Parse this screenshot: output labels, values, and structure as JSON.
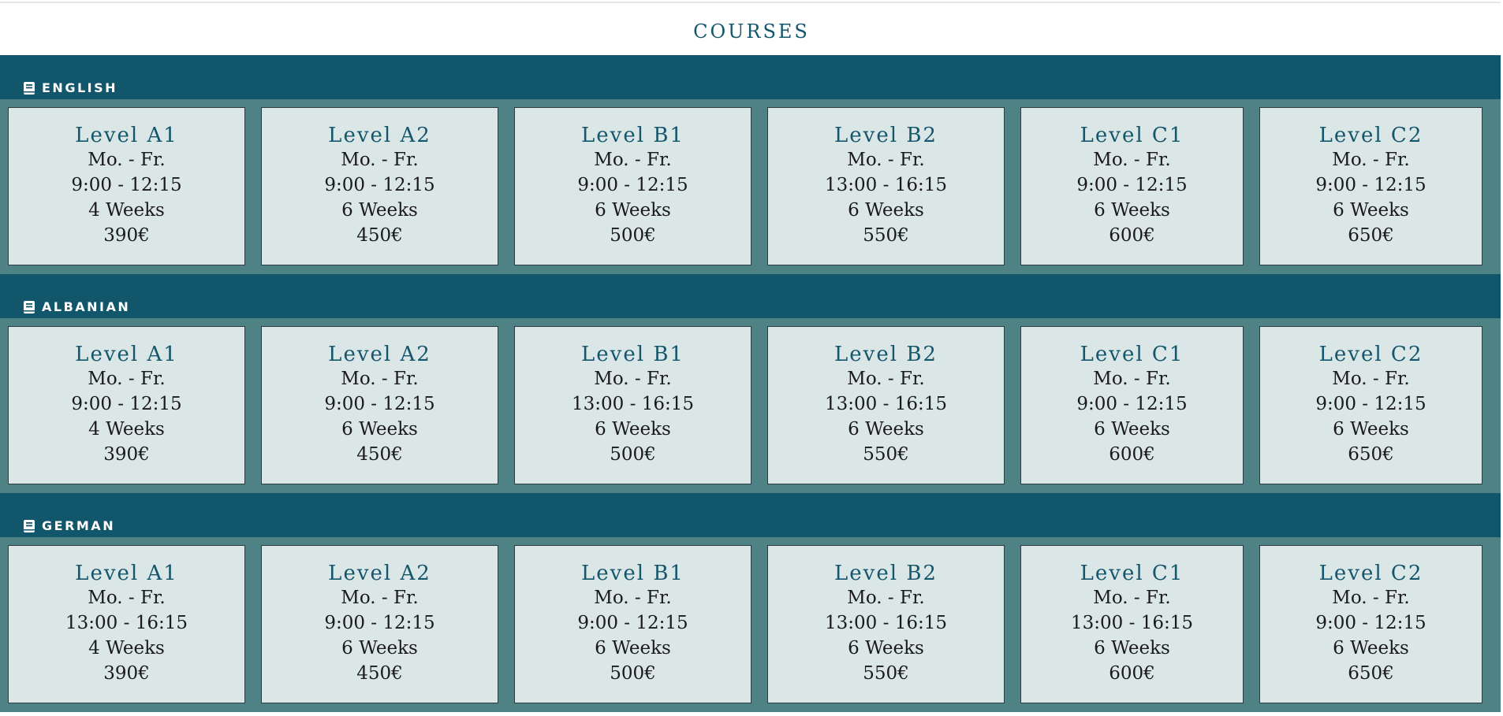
{
  "page": {
    "title": "COURSES"
  },
  "sections": [
    {
      "name": "ENGLISH",
      "icon": "book-icon",
      "courses": [
        {
          "level": "Level A1",
          "days": "Mo. - Fr.",
          "time": "9:00 - 12:15",
          "duration": "4 Weeks",
          "price": "390€"
        },
        {
          "level": "Level A2",
          "days": "Mo. - Fr.",
          "time": "9:00 - 12:15",
          "duration": "6 Weeks",
          "price": "450€"
        },
        {
          "level": "Level B1",
          "days": "Mo. - Fr.",
          "time": "9:00 - 12:15",
          "duration": "6 Weeks",
          "price": "500€"
        },
        {
          "level": "Level B2",
          "days": "Mo. - Fr.",
          "time": "13:00 - 16:15",
          "duration": "6 Weeks",
          "price": "550€"
        },
        {
          "level": "Level C1",
          "days": "Mo. - Fr.",
          "time": "9:00 - 12:15",
          "duration": "6 Weeks",
          "price": "600€"
        },
        {
          "level": "Level C2",
          "days": "Mo. - Fr.",
          "time": "9:00 - 12:15",
          "duration": "6 Weeks",
          "price": "650€"
        }
      ]
    },
    {
      "name": "ALBANIAN",
      "icon": "book-icon",
      "courses": [
        {
          "level": "Level A1",
          "days": "Mo. - Fr.",
          "time": "9:00 - 12:15",
          "duration": "4 Weeks",
          "price": "390€"
        },
        {
          "level": "Level A2",
          "days": "Mo. - Fr.",
          "time": "9:00 - 12:15",
          "duration": "6 Weeks",
          "price": "450€"
        },
        {
          "level": "Level B1",
          "days": "Mo. - Fr.",
          "time": "13:00 - 16:15",
          "duration": "6 Weeks",
          "price": "500€"
        },
        {
          "level": "Level B2",
          "days": "Mo. - Fr.",
          "time": "13:00 - 16:15",
          "duration": "6 Weeks",
          "price": "550€"
        },
        {
          "level": "Level C1",
          "days": "Mo. - Fr.",
          "time": "9:00 - 12:15",
          "duration": "6 Weeks",
          "price": "600€"
        },
        {
          "level": "Level C2",
          "days": "Mo. - Fr.",
          "time": "9:00 - 12:15",
          "duration": "6 Weeks",
          "price": "650€"
        }
      ]
    },
    {
      "name": "GERMAN",
      "icon": "book-icon",
      "courses": [
        {
          "level": "Level A1",
          "days": "Mo. - Fr.",
          "time": "13:00 - 16:15",
          "duration": "4 Weeks",
          "price": "390€"
        },
        {
          "level": "Level A2",
          "days": "Mo. - Fr.",
          "time": "9:00 - 12:15",
          "duration": "6 Weeks",
          "price": "450€"
        },
        {
          "level": "Level B1",
          "days": "Mo. - Fr.",
          "time": "9:00 - 12:15",
          "duration": "6 Weeks",
          "price": "500€"
        },
        {
          "level": "Level B2",
          "days": "Mo. - Fr.",
          "time": "13:00 - 16:15",
          "duration": "6 Weeks",
          "price": "550€"
        },
        {
          "level": "Level C1",
          "days": "Mo. - Fr.",
          "time": "13:00 - 16:15",
          "duration": "6 Weeks",
          "price": "600€"
        },
        {
          "level": "Level C2",
          "days": "Mo. - Fr.",
          "time": "9:00 - 12:15",
          "duration": "6 Weeks",
          "price": "650€"
        }
      ]
    }
  ],
  "colors": {
    "header_band": "#11566b",
    "section_background": "#4e8285",
    "card_background": "#dbe7e7",
    "level_text": "#14566c",
    "title_text": "#14566c"
  }
}
